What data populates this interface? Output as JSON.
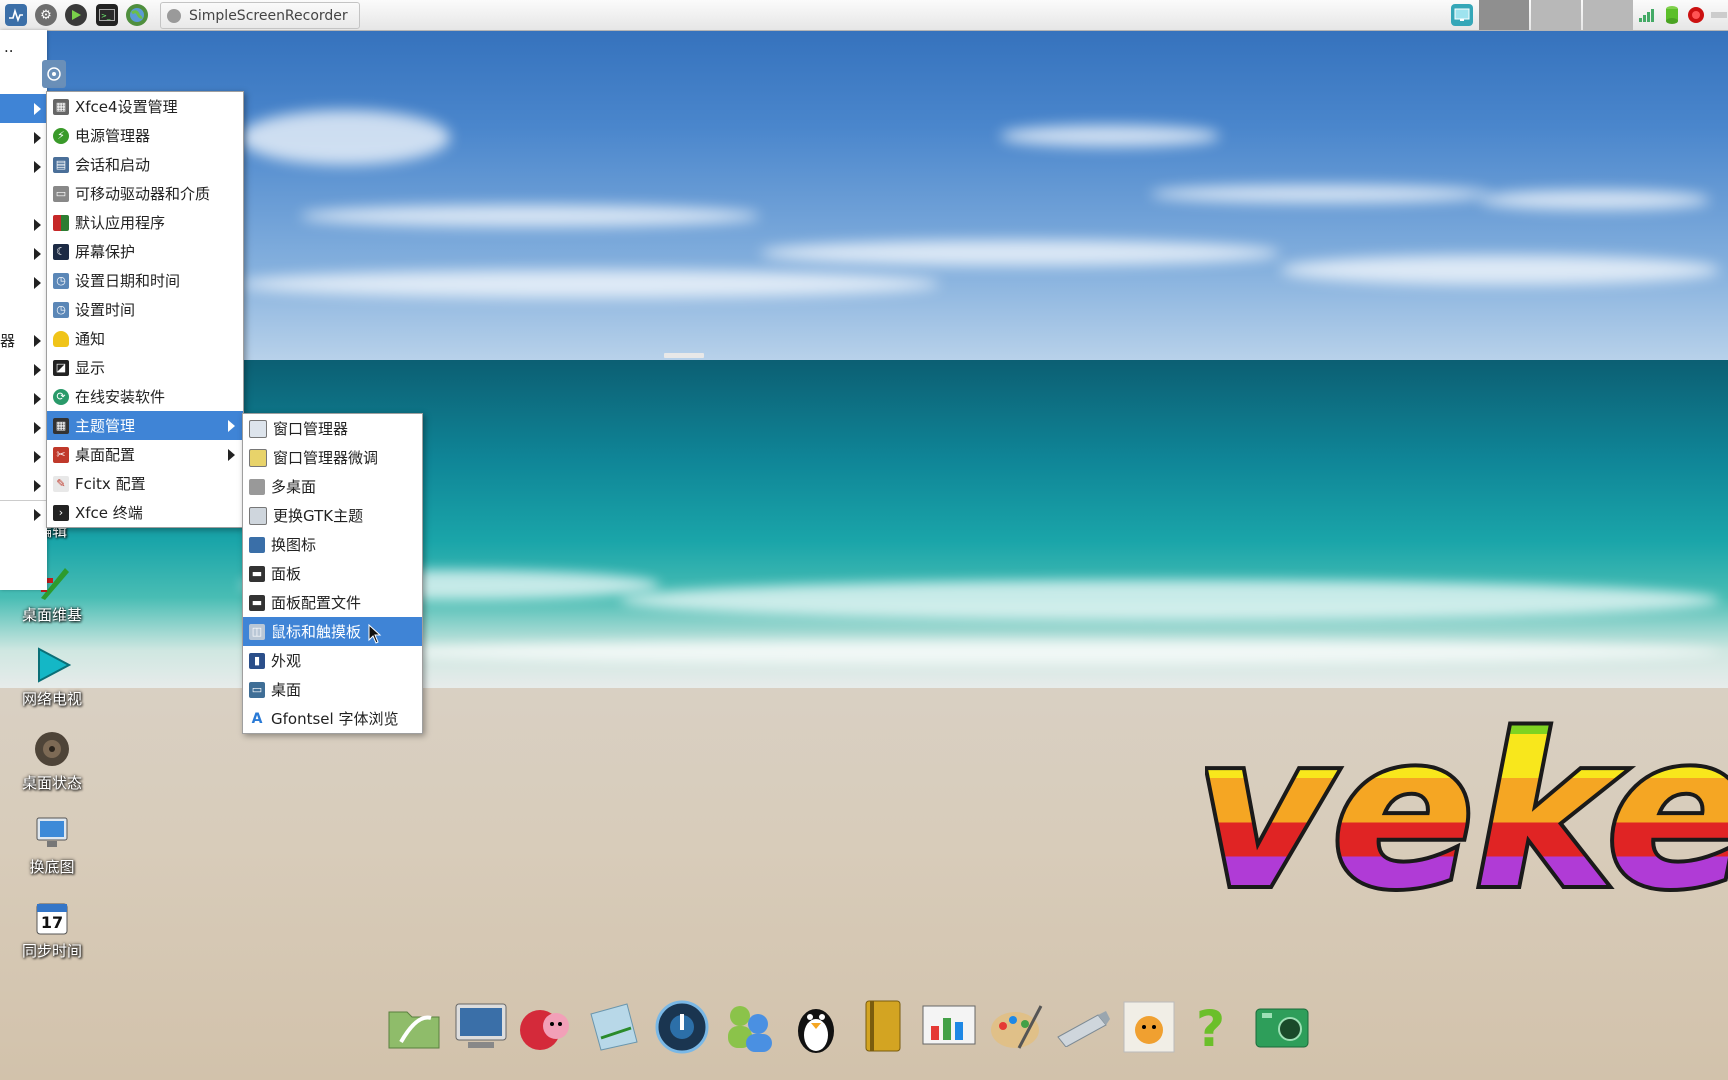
{
  "taskbar": {
    "window_button_label": "SimpleScreenRecorder"
  },
  "left_menu": {
    "top_text": "..",
    "partial_label": "器"
  },
  "settings_menu": {
    "items": [
      {
        "label": "Xfce4设置管理",
        "icon": "settings-manager-icon",
        "has_submenu": false
      },
      {
        "label": "电源管理器",
        "icon": "power-manager-icon",
        "has_submenu": false
      },
      {
        "label": "会话和启动",
        "icon": "session-icon",
        "has_submenu": false
      },
      {
        "label": "可移动驱动器和介质",
        "icon": "removable-drive-icon",
        "has_submenu": false
      },
      {
        "label": "默认应用程序",
        "icon": "default-apps-icon",
        "has_submenu": false
      },
      {
        "label": "屏幕保护",
        "icon": "screensaver-icon",
        "has_submenu": false
      },
      {
        "label": "设置日期和时间",
        "icon": "datetime-icon",
        "has_submenu": false
      },
      {
        "label": "设置时间",
        "icon": "time-icon",
        "has_submenu": false
      },
      {
        "label": "通知",
        "icon": "bell-icon",
        "has_submenu": false
      },
      {
        "label": "显示",
        "icon": "display-icon",
        "has_submenu": false
      },
      {
        "label": "在线安装软件",
        "icon": "online-install-icon",
        "has_submenu": false
      },
      {
        "label": "主题管理",
        "icon": "theme-icon",
        "has_submenu": true,
        "highlighted": true
      },
      {
        "label": "桌面配置",
        "icon": "desktop-config-icon",
        "has_submenu": true
      },
      {
        "label": "Fcitx 配置",
        "icon": "fcitx-icon",
        "has_submenu": false
      },
      {
        "label": "Xfce 终端",
        "icon": "terminal-icon",
        "has_submenu": false
      }
    ]
  },
  "theme_submenu": {
    "items": [
      {
        "label": "窗口管理器",
        "icon": "window-manager-icon"
      },
      {
        "label": "窗口管理器微调",
        "icon": "wm-tweaks-icon"
      },
      {
        "label": "多桌面",
        "icon": "workspaces-icon"
      },
      {
        "label": "更换GTK主题",
        "icon": "gtk-theme-icon"
      },
      {
        "label": "换图标",
        "icon": "change-icons-icon"
      },
      {
        "label": "面板",
        "icon": "panel-icon"
      },
      {
        "label": "面板配置文件",
        "icon": "panel-profile-icon"
      },
      {
        "label": "鼠标和触摸板",
        "icon": "mouse-icon",
        "highlighted": true
      },
      {
        "label": "外观",
        "icon": "appearance-icon"
      },
      {
        "label": "桌面",
        "icon": "desktop-icon"
      },
      {
        "label": "Gfontsel 字体浏览",
        "icon": "font-icon"
      }
    ]
  },
  "desktop_icons": [
    {
      "label": "编辑",
      "icon": "edit-icon"
    },
    {
      "label": "桌面维基",
      "icon": "wiki-icon"
    },
    {
      "label": "网络电视",
      "icon": "play-icon"
    },
    {
      "label": "桌面状态",
      "icon": "status-icon"
    },
    {
      "label": "换底图",
      "icon": "wallpaper-icon"
    },
    {
      "label": "同步时间",
      "icon": "calendar-icon"
    }
  ],
  "calendar_day": "17",
  "logo_text": "veket",
  "dock": {
    "items": [
      "file-manager-icon",
      "monitor-icon",
      "pet-icon",
      "notebook-icon",
      "media-player-icon",
      "users-icon",
      "penguin-icon",
      "book-icon",
      "presentation-icon",
      "paint-icon",
      "usb-drive-icon",
      "veket-app-icon",
      "help-icon",
      "camera-icon"
    ]
  },
  "colors": {
    "menu_highlight": "#3f84d6"
  }
}
